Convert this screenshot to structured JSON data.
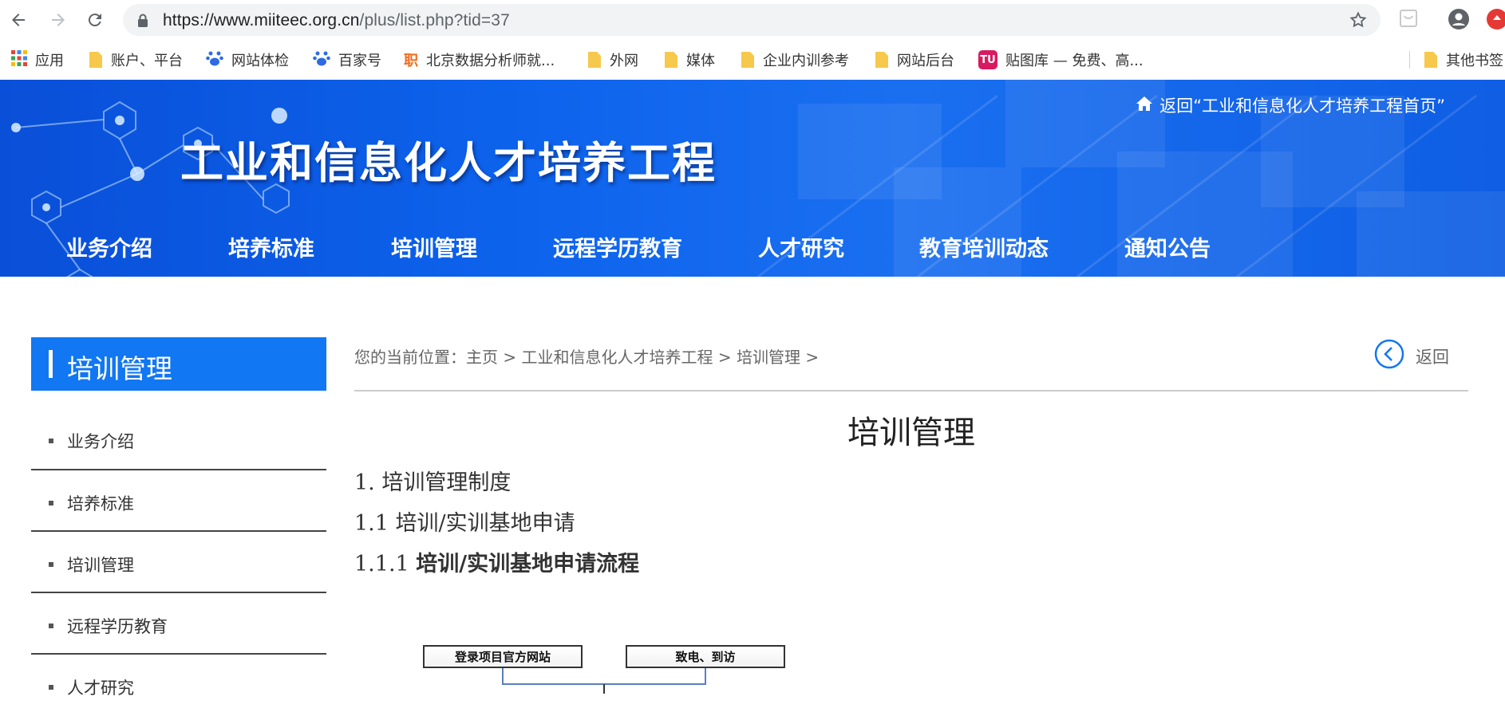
{
  "browser": {
    "url_host": "https://www.miiteec.org.cn",
    "url_path": "/plus/list.php?tid=37",
    "bookmarks": [
      {
        "label": "应用",
        "icon": "apps-grid-icon"
      },
      {
        "label": "账户、平台",
        "icon": "folder-icon"
      },
      {
        "label": "网站体检",
        "icon": "baidu-paw-icon"
      },
      {
        "label": "百家号",
        "icon": "baidu-paw-icon"
      },
      {
        "label": "北京数据分析师就...",
        "icon": "job-icon"
      },
      {
        "label": "外网",
        "icon": "folder-icon"
      },
      {
        "label": "媒体",
        "icon": "folder-icon"
      },
      {
        "label": "企业内训参考",
        "icon": "folder-icon"
      },
      {
        "label": "网站后台",
        "icon": "folder-icon"
      },
      {
        "label": "贴图库 — 免费、高...",
        "icon": "tu-icon"
      },
      {
        "label": "其他书签",
        "icon": "folder-icon"
      }
    ],
    "tu_badge": "TU",
    "job_badge": "职"
  },
  "header": {
    "title": "工业和信息化人才培养工程",
    "home_link": "返回“工业和信息化人才培养工程首页”",
    "nav": [
      "业务介绍",
      "培养标准",
      "培训管理",
      "远程学历教育",
      "人才研究",
      "教育培训动态",
      "通知公告"
    ]
  },
  "sidebar": {
    "title": "培训管理",
    "items": [
      "业务介绍",
      "培养标准",
      "培训管理",
      "远程学历教育",
      "人才研究"
    ]
  },
  "content": {
    "breadcrumb": {
      "prefix": "您的当前位置：",
      "items": [
        "主页",
        "工业和信息化人才培养工程",
        "培训管理"
      ],
      "sep": " > "
    },
    "back_label": "返回",
    "title": "培训管理",
    "lines": {
      "l1": "1.  培训管理制度",
      "l2": "1.1  培训/实训基地申请",
      "l3_num": "1.1.1  ",
      "l3_text": "培训/实训基地申请流程"
    },
    "flow": [
      "登录项目官方网站",
      "致电、到访"
    ]
  }
}
